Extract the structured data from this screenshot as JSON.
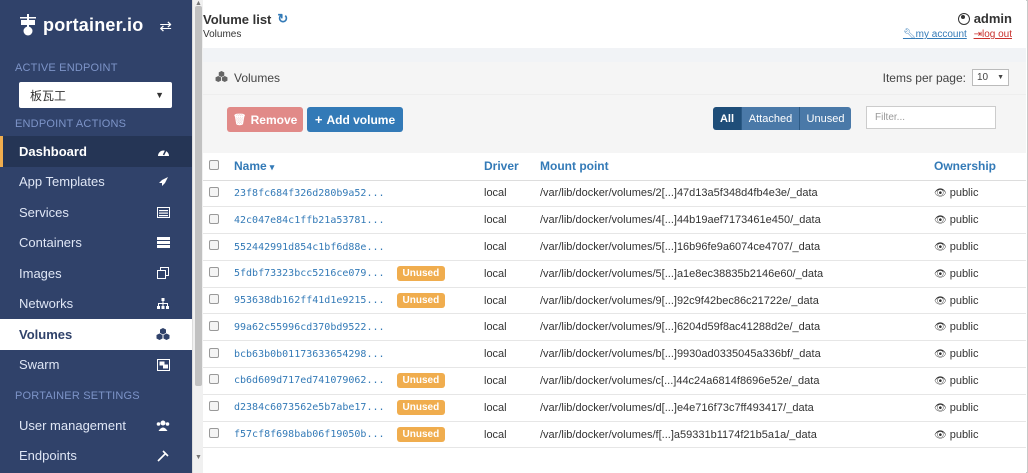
{
  "sidebar": {
    "brand": "portainer.io",
    "active_endpoint_title": "ACTIVE ENDPOINT",
    "endpoint_value": "板瓦工",
    "endpoint_actions_title": "ENDPOINT ACTIONS",
    "items": [
      {
        "label": "Dashboard",
        "icon": "tachometer-icon"
      },
      {
        "label": "App Templates",
        "icon": "rocket-icon"
      },
      {
        "label": "Services",
        "icon": "list-alt-icon"
      },
      {
        "label": "Containers",
        "icon": "server-icon"
      },
      {
        "label": "Images",
        "icon": "clone-icon"
      },
      {
        "label": "Networks",
        "icon": "sitemap-icon"
      },
      {
        "label": "Volumes",
        "icon": "cubes-icon"
      },
      {
        "label": "Swarm",
        "icon": "object-group-icon"
      }
    ],
    "settings_title": "PORTAINER SETTINGS",
    "settings_items": [
      {
        "label": "User management",
        "icon": "users-icon"
      },
      {
        "label": "Endpoints",
        "icon": "plug-icon"
      }
    ]
  },
  "header": {
    "title": "Volume list",
    "breadcrumb": "Volumes",
    "username": "admin",
    "my_account": "my account",
    "log_out": "log out"
  },
  "widget": {
    "title": "Volumes",
    "items_per_page_label": "Items per page:",
    "items_per_page_value": "10",
    "remove_label": "Remove",
    "add_label": "Add volume",
    "filters": [
      "All",
      "Attached",
      "Unused"
    ],
    "filter_placeholder": "Filter..."
  },
  "table": {
    "headers": {
      "name": "Name",
      "driver": "Driver",
      "mount": "Mount point",
      "ownership": "Ownership"
    },
    "rows": [
      {
        "name": "23f8fc684f326d280b9a52...",
        "unused": "",
        "driver": "local",
        "mount": "/var/lib/docker/volumes/2[...]47d13a5f348d4fb4e3e/_data",
        "ownership": "public"
      },
      {
        "name": "42c047e84c1ffb21a53781...",
        "unused": "",
        "driver": "local",
        "mount": "/var/lib/docker/volumes/4[...]44b19aef7173461e450/_data",
        "ownership": "public"
      },
      {
        "name": "552442991d854c1bf6d88e...",
        "unused": "",
        "driver": "local",
        "mount": "/var/lib/docker/volumes/5[...]16b96fe9a6074ce4707/_data",
        "ownership": "public"
      },
      {
        "name": "5fdbf73323bcc5216ce079...",
        "unused": "Unused",
        "driver": "local",
        "mount": "/var/lib/docker/volumes/5[...]a1e8ec38835b2146e60/_data",
        "ownership": "public"
      },
      {
        "name": "953638db162ff41d1e9215...",
        "unused": "Unused",
        "driver": "local",
        "mount": "/var/lib/docker/volumes/9[...]92c9f42bec86c21722e/_data",
        "ownership": "public"
      },
      {
        "name": "99a62c55996cd370bd9522...",
        "unused": "",
        "driver": "local",
        "mount": "/var/lib/docker/volumes/9[...]6204d59f8ac41288d2e/_data",
        "ownership": "public"
      },
      {
        "name": "bcb63b0b01173633654298...",
        "unused": "",
        "driver": "local",
        "mount": "/var/lib/docker/volumes/b[...]9930ad0335045a336bf/_data",
        "ownership": "public"
      },
      {
        "name": "cb6d609d717ed741079062...",
        "unused": "Unused",
        "driver": "local",
        "mount": "/var/lib/docker/volumes/c[...]44c24a6814f8696e52e/_data",
        "ownership": "public"
      },
      {
        "name": "d2384c6073562e5b7abe17...",
        "unused": "Unused",
        "driver": "local",
        "mount": "/var/lib/docker/volumes/d[...]e4e716f73c7ff493417/_data",
        "ownership": "public"
      },
      {
        "name": "f57cf8f698bab06f19050b...",
        "unused": "Unused",
        "driver": "local",
        "mount": "/var/lib/docker/volumes/f[...]a59331b1174f21b5a1a/_data",
        "ownership": "public"
      }
    ]
  },
  "colors": {
    "sidebar": "#30426a",
    "primary": "#337ab7",
    "unused_badge": "#f0ad4e",
    "danger": "#e18a88"
  }
}
